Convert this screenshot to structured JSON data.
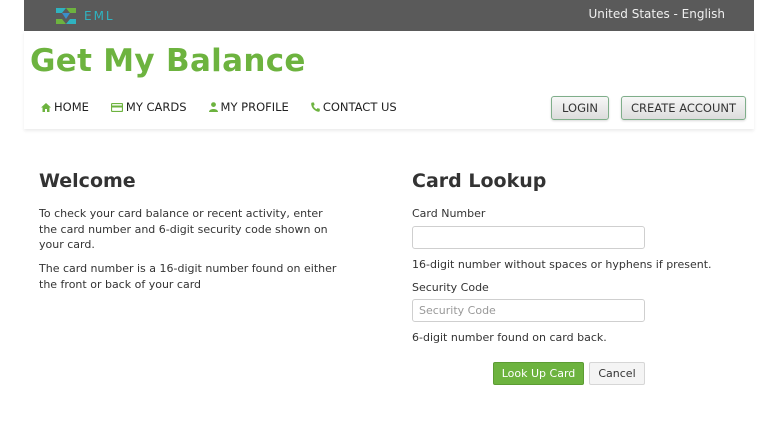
{
  "topbar": {
    "logo_text": "EML",
    "locale": "United States - English"
  },
  "header": {
    "brand": "Get My Balance",
    "nav": [
      {
        "label": "HOME",
        "icon": "home-icon"
      },
      {
        "label": "MY CARDS",
        "icon": "credit-card-icon"
      },
      {
        "label": "MY PROFILE",
        "icon": "user-icon"
      },
      {
        "label": "CONTACT US",
        "icon": "phone-icon"
      }
    ],
    "login_label": "LOGIN",
    "create_label": "CREATE ACCOUNT"
  },
  "welcome": {
    "title": "Welcome",
    "p1": "To check your card balance or recent activity, enter the card number and 6-digit security code shown on your card.",
    "p2": "The card number is a 16-digit number found on either the front or back of your card"
  },
  "lookup": {
    "title": "Card Lookup",
    "card_label": "Card Number",
    "card_value": "",
    "card_placeholder": "",
    "card_help": "16-digit number without spaces or hyphens if present.",
    "security_label": "Security Code",
    "security_value": "",
    "security_placeholder": "Security Code",
    "security_help": "6-digit number found on card back.",
    "submit_label": "Look Up Card",
    "cancel_label": "Cancel"
  },
  "colors": {
    "brand_green": "#6db33f",
    "topbar": "#5a5a5a",
    "logo_teal": "#2fb3c0"
  }
}
